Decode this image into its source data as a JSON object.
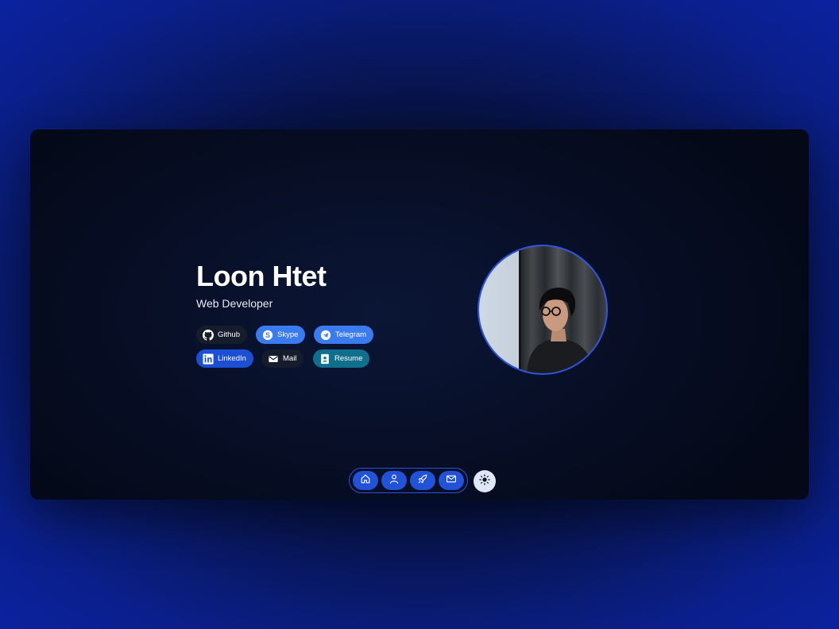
{
  "profile": {
    "name": "Loon Htet",
    "role": "Web Developer"
  },
  "links": {
    "github": "Github",
    "skype": "Skype",
    "telegram": "Telegram",
    "linkedin": "LinkedIn",
    "mail": "Mail",
    "resume": "Resume"
  },
  "dock": {
    "items": [
      "home-icon",
      "user-icon",
      "rocket-icon",
      "mail-icon"
    ],
    "theme_toggle": "sun-icon"
  },
  "colors": {
    "accent": "#2152d8",
    "chip_dark": "#161c2b",
    "chip_blue": "#3a7cf0",
    "chip_royal": "#1d4fd6",
    "chip_teal": "#0f6f8c",
    "background": "#0b22a3"
  }
}
